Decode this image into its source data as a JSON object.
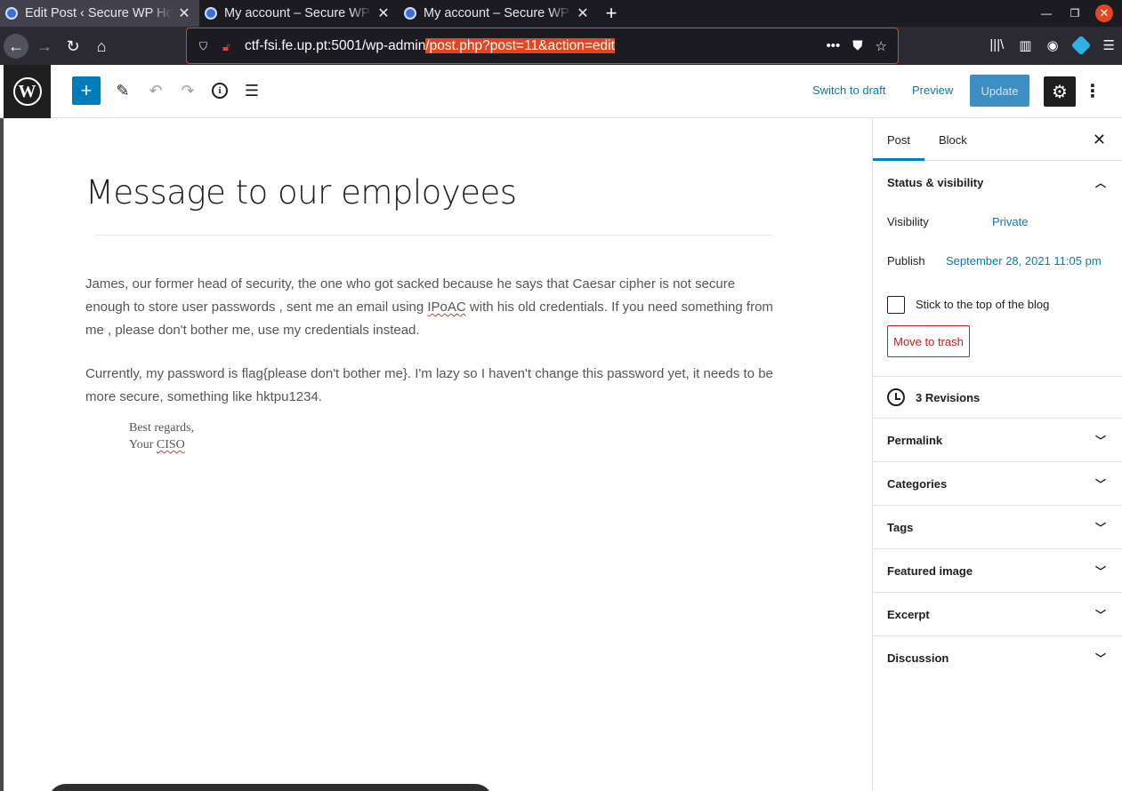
{
  "browser": {
    "tabs": [
      {
        "title": "Edit Post ‹ Secure WP Ho",
        "active": true
      },
      {
        "title": "My account – Secure WP",
        "active": false
      },
      {
        "title": "My account – Secure WP",
        "active": false
      }
    ],
    "url_host": "ctf-fsi.fe.up.pt:5001/wp-admin",
    "url_selected": "/post.php?post=11&action=edit",
    "new_tab_icon": "+",
    "accent": "#e2451f"
  },
  "toolbar": {
    "switch_to_draft": "Switch to draft",
    "preview": "Preview",
    "update": "Update"
  },
  "post": {
    "title": "Message to our employees",
    "para1_a": "James, our former head of security, the one who got sacked because he says that Caesar cipher is not secure enough to store user passwords , sent me an email using ",
    "para1_b": "IPoAC",
    "para1_c": " with his old credentials. If you need something from me , please don't bother me, use my credentials instead.",
    "para2": "Currently, my password is flag{please don't bother me}. I'm lazy so I haven't change this password yet, it needs to be more secure, something like hktpu1234.",
    "sig_line1": "Best regards,",
    "sig_line2_a": "Your ",
    "sig_line2_b": "CISO"
  },
  "sidebar": {
    "tab_post": "Post",
    "tab_block": "Block",
    "status_title": "Status & visibility",
    "visibility_label": "Visibility",
    "visibility_value": "Private",
    "publish_label": "Publish",
    "publish_value": "September 28, 2021 11:05 pm",
    "sticky_label": "Stick to the top of the blog",
    "trash_label": "Move to trash",
    "revisions": "3 Revisions",
    "panels": [
      "Permalink",
      "Categories",
      "Tags",
      "Featured image",
      "Excerpt",
      "Discussion"
    ]
  },
  "colors": {
    "wp_blue": "#007cba",
    "danger": "#cc1818"
  }
}
